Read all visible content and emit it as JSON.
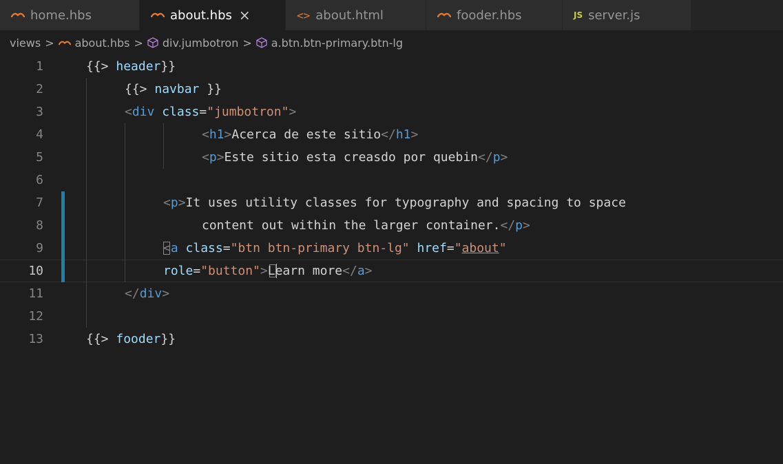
{
  "tabs": [
    {
      "label": "home.hbs",
      "icon": "handlebars-icon",
      "active": false
    },
    {
      "label": "about.hbs",
      "icon": "handlebars-icon",
      "active": true,
      "close": "×"
    },
    {
      "label": "about.html",
      "icon": "html-icon",
      "icon_glyph": "<>",
      "active": false
    },
    {
      "label": "fooder.hbs",
      "icon": "handlebars-icon",
      "active": false
    },
    {
      "label": "server.js",
      "icon": "js-icon",
      "icon_glyph": "JS",
      "active": false
    }
  ],
  "breadcrumb": {
    "items": [
      "views",
      "about.hbs",
      "div.jumbotron",
      "a.btn.btn-primary.btn-lg"
    ],
    "separator": ">"
  },
  "editor": {
    "line_numbers": [
      "1",
      "2",
      "3",
      "4",
      "5",
      "6",
      "7",
      "8",
      "9",
      "10",
      "11",
      "12",
      "13"
    ],
    "current_line": 10,
    "tokens": {
      "l1_open": "{{>",
      "l1_name": " header",
      "l1_close": "}}",
      "l2_open": "{{>",
      "l2_name": " navbar ",
      "l2_close": "}}",
      "l3_lt": "<",
      "l3_tag": "div",
      "l3_attr": " class",
      "l3_eq": "=",
      "l3_val": "\"jumbotron\"",
      "l3_gt": ">",
      "l4_lt": "<",
      "l4_tag": "h1",
      "l4_gt": ">",
      "l4_text": "Acerca de este sitio",
      "l4_clt": "</",
      "l4_ctag": "h1",
      "l4_cgt": ">",
      "l5_lt": "<",
      "l5_tag": "p",
      "l5_gt": ">",
      "l5_text": "Este sitio esta creasdo por quebin",
      "l5_clt": "</",
      "l5_ctag": "p",
      "l5_cgt": ">",
      "l7_lt": "<",
      "l7_tag": "p",
      "l7_gt": ">",
      "l7_text": "It uses utility classes for typography and spacing to space",
      "l8_text": "content out within the larger container.",
      "l8_clt": "</",
      "l8_ctag": "p",
      "l8_cgt": ">",
      "l9_lt": "<",
      "l9_tag": "a",
      "l9_attr1": " class",
      "l9_eq1": "=",
      "l9_val1": "\"btn btn-primary btn-lg\"",
      "l9_attr2": " href",
      "l9_eq2": "=",
      "l9_q1": "\"",
      "l9_val2": "about",
      "l9_q2": "\"",
      "l10_attr": "role",
      "l10_eq": "=",
      "l10_val": "\"button\"",
      "l10_gt": ">",
      "l10_text": "Learn more",
      "l10_clt": "</",
      "l10_ctag": "a",
      "l10_cgt": ">",
      "l11_clt": "</",
      "l11_ctag": "div",
      "l11_cgt": ">",
      "l13_open": "{{>",
      "l13_name": " fooder",
      "l13_close": "}}"
    }
  },
  "colors": {
    "background": "#1e1e1e",
    "tag": "#569cd6",
    "attribute": "#9cdcfe",
    "string": "#ce9178",
    "modified_gutter": "#1b81a8",
    "handlebars_icon": "#e37933",
    "js_icon": "#cbcb41"
  }
}
